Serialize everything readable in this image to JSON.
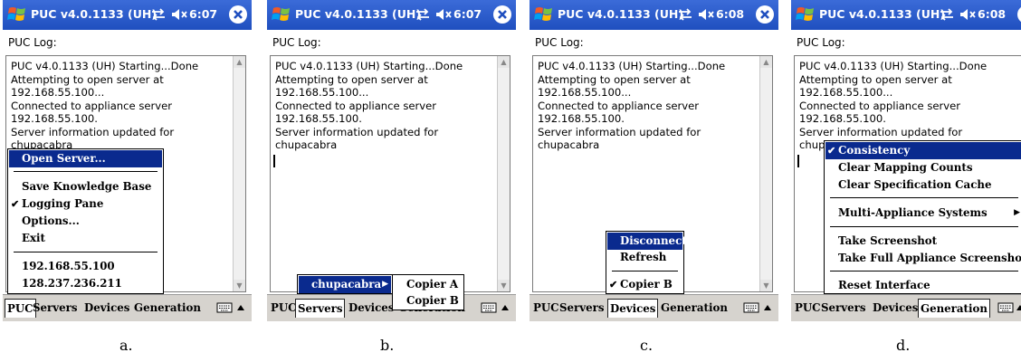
{
  "screens": [
    {
      "title": "PUC v4.0.1133 (UH)",
      "time": "6:07",
      "log_label": "PUC Log:",
      "log_lines": [
        "PUC v4.0.1133 (UH) Starting...Done",
        "Attempting to open server at",
        "192.168.55.100...",
        "Connected to appliance server",
        "192.168.55.100.",
        "Server information updated for",
        "chupacabra"
      ],
      "menubar": [
        "PUC",
        "Servers",
        "Devices",
        "Generation"
      ],
      "caption": "a."
    },
    {
      "title": "PUC v4.0.1133 (UH)",
      "time": "6:07",
      "log_label": "PUC Log:",
      "log_lines": [
        "PUC v4.0.1133 (UH) Starting...Done",
        "Attempting to open server at",
        "192.168.55.100...",
        "Connected to appliance server",
        "192.168.55.100.",
        "Server information updated for",
        "chupacabra"
      ],
      "menubar": [
        "PUC",
        "Servers",
        "Devices",
        "Generation"
      ],
      "caption": "b."
    },
    {
      "title": "PUC v4.0.1133 (UH)",
      "time": "6:08",
      "log_label": "PUC Log:",
      "log_lines": [
        "PUC v4.0.1133 (UH) Starting...Done",
        "Attempting to open server at",
        "192.168.55.100...",
        "Connected to appliance server",
        "192.168.55.100.",
        "Server information updated for",
        "chupacabra"
      ],
      "menubar": [
        "PUC",
        "Servers",
        "Devices",
        "Generation"
      ],
      "caption": "c."
    },
    {
      "title": "PUC v4.0.1133 (UH)",
      "time": "6:08",
      "log_label": "PUC Log:",
      "log_lines": [
        "PUC v4.0.1133 (UH) Starting...Done",
        "Attempting to open server at",
        "192.168.55.100...",
        "Connected to appliance server",
        "192.168.55.100.",
        "Server information updated for",
        "chup"
      ],
      "menubar": [
        "PUC",
        "Servers",
        "Devices",
        "Generation"
      ],
      "caption": "d."
    }
  ],
  "menu_a": {
    "open_server": "Open Server...",
    "save_kb": "Save Knowledge Base",
    "logging_pane": "Logging Pane",
    "options": "Options...",
    "exit": "Exit",
    "server_1": "192.168.55.100",
    "server_2": "128.237.236.211"
  },
  "menu_b": {
    "server": "chupacabra",
    "copier_a": "Copier A",
    "copier_b": "Copier B"
  },
  "menu_c": {
    "disconnect": "Disconnect",
    "refresh": "Refresh",
    "copier_b": "Copier B"
  },
  "menu_d": {
    "consistency": "Consistency",
    "clear_mapping": "Clear Mapping Counts",
    "clear_spec": "Clear Specification Cache",
    "multi_appliance": "Multi-Appliance Systems",
    "screenshot": "Take Screenshot",
    "full_screenshot": "Take Full Appliance Screenshot",
    "reset": "Reset Interface"
  },
  "colors": {
    "titlebar": "#2456c8",
    "menu_highlight": "#0a2a8e",
    "menubar": "#d6d3ce"
  },
  "icons": [
    "windows-logo-icon",
    "connectivity-icon",
    "speaker-muted-icon",
    "close-icon",
    "keyboard-icon",
    "chevron-up-icon",
    "checkmark-icon",
    "submenu-arrow-icon"
  ]
}
